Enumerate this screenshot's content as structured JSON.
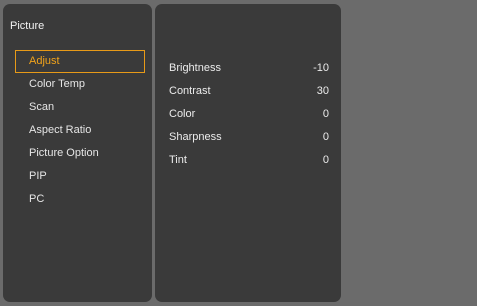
{
  "menu": {
    "title": "Picture",
    "items": [
      {
        "label": "Adjust",
        "selected": true
      },
      {
        "label": "Color Temp",
        "selected": false
      },
      {
        "label": "Scan",
        "selected": false
      },
      {
        "label": "Aspect Ratio",
        "selected": false
      },
      {
        "label": "Picture Option",
        "selected": false
      },
      {
        "label": "PIP",
        "selected": false
      },
      {
        "label": "PC",
        "selected": false
      }
    ]
  },
  "settings": [
    {
      "label": "Brightness",
      "value": "-10"
    },
    {
      "label": "Contrast",
      "value": "30"
    },
    {
      "label": "Color",
      "value": "0"
    },
    {
      "label": "Sharpness",
      "value": "0"
    },
    {
      "label": "Tint",
      "value": "0"
    }
  ],
  "colors": {
    "background": "#6b6b6b",
    "panel": "#3a3a3a",
    "highlight": "#f1a31b",
    "text": "#ececec"
  }
}
